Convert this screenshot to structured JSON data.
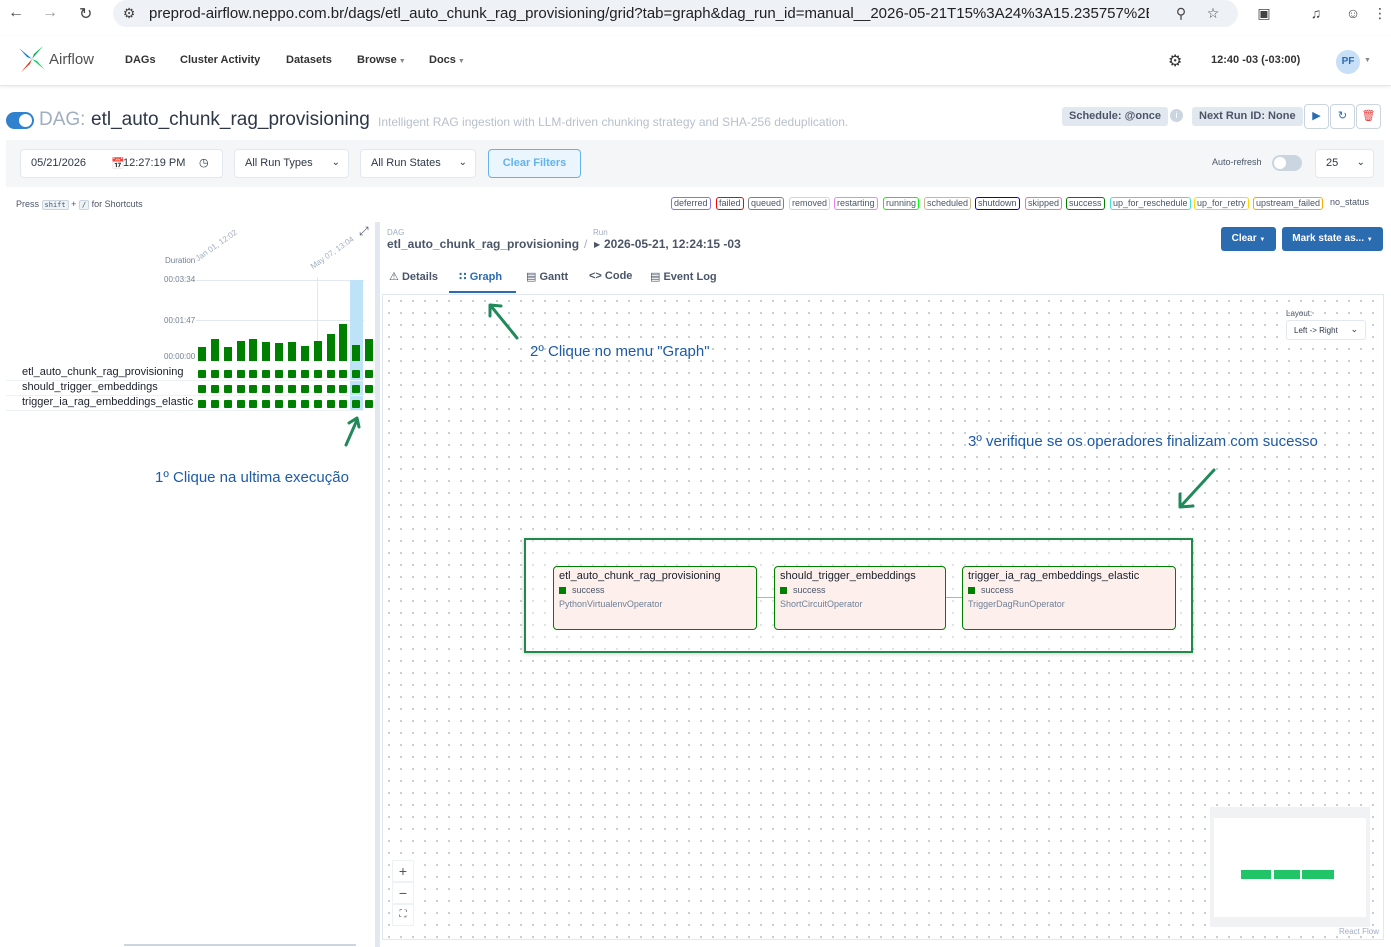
{
  "browser": {
    "url": "preprod-airflow.neppo.com.br/dags/etl_auto_chunk_rag_provisioning/grid?tab=graph&dag_run_id=manual__2026-05-21T15%3A24%3A15.235757%2B..."
  },
  "topnav": {
    "logo": "Airflow",
    "links": [
      "DAGs",
      "Cluster Activity",
      "Datasets",
      "Browse",
      "Docs"
    ],
    "time": "12:40 -03 (-03:00)",
    "user_initials": "PF"
  },
  "dag": {
    "prefix": "DAG:",
    "id": "etl_auto_chunk_rag_provisioning",
    "description": "Intelligent RAG ingestion with LLM-driven chunking strategy and SHA-256 deduplication.",
    "schedule": "Schedule: @once",
    "next_run": "Next Run ID: None"
  },
  "filters": {
    "date": "05/21/2026",
    "time": "12:27:19 PM",
    "run_types": "All Run Types",
    "run_states": "All Run States",
    "clear_filters": "Clear Filters",
    "auto_refresh": "Auto-refresh",
    "page_size": "25"
  },
  "shortcuts": {
    "press": "Press",
    "key1": "shift",
    "plus": "+",
    "key2": "/",
    "suffix": "for Shortcuts"
  },
  "legend": [
    {
      "label": "deferred",
      "color": "#9370db"
    },
    {
      "label": "failed",
      "color": "#ff0000"
    },
    {
      "label": "queued",
      "color": "#808080"
    },
    {
      "label": "removed",
      "color": "#d3d3d3"
    },
    {
      "label": "restarting",
      "color": "#ee82ee"
    },
    {
      "label": "running",
      "color": "#00ff00"
    },
    {
      "label": "scheduled",
      "color": "#d2b48c"
    },
    {
      "label": "shutdown",
      "color": "#0000ff"
    },
    {
      "label": "skipped",
      "color": "#ff69b4"
    },
    {
      "label": "success",
      "color": "#008000"
    },
    {
      "label": "up_for_reschedule",
      "color": "#40e0d0"
    },
    {
      "label": "up_for_retry",
      "color": "#ffd700"
    },
    {
      "label": "upstream_failed",
      "color": "#ffa500"
    },
    {
      "label": "no_status",
      "color": "#ffffff"
    }
  ],
  "grid": {
    "duration_label": "Duration",
    "y_ticks": [
      "00:03:34",
      "00:01:47",
      "00:00:00"
    ],
    "date_labels": [
      "Jan 01, 12:02",
      "May 07, 13:04"
    ],
    "durations_seconds": [
      38,
      58,
      38,
      52,
      58,
      51,
      47,
      49,
      39,
      52,
      71,
      97,
      41,
      58
    ],
    "tasks": [
      "etl_auto_chunk_rag_provisioning",
      "should_trigger_embeddings",
      "trigger_ia_rag_embeddings_elastic"
    ],
    "statuses": "success"
  },
  "annotations": {
    "step1": "1º Clique na ultima execução",
    "step2": "2º Clique no menu \"Graph\"",
    "step3": "3º verifique se os operadores finalizam com sucesso"
  },
  "breadcrumb": {
    "dag_label": "DAG",
    "dag_value": "etl_auto_chunk_rag_provisioning",
    "sep": "/",
    "run_label": "Run",
    "run_value": "2026-05-21, 12:24:15 -03"
  },
  "actions": {
    "clear": "Clear",
    "mark_state": "Mark state as..."
  },
  "tabs": [
    "Details",
    "Graph",
    "Gantt",
    "Code",
    "Event Log"
  ],
  "graph": {
    "layout_label": "Layout:",
    "layout_value": "Left -> Right",
    "nodes": [
      {
        "name": "etl_auto_chunk_rag_provisioning",
        "status": "success",
        "operator": "PythonVirtualenvOperator"
      },
      {
        "name": "should_trigger_embeddings",
        "status": "success",
        "operator": "ShortCircuitOperator"
      },
      {
        "name": "trigger_ia_rag_embeddings_elastic",
        "status": "success",
        "operator": "TriggerDagRunOperator"
      }
    ],
    "attribution": "React Flow"
  }
}
